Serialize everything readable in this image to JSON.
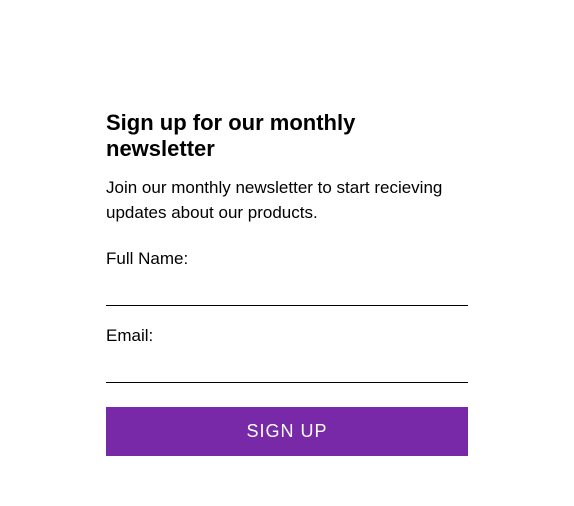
{
  "heading": "Sign up for our monthly newsletter",
  "description": "Join our monthly newsletter to start recieving updates about our products.",
  "fields": {
    "fullname": {
      "label": "Full Name:",
      "value": ""
    },
    "email": {
      "label": "Email:",
      "value": ""
    }
  },
  "submit_label": "SIGN UP",
  "colors": {
    "accent": "#7829a8"
  }
}
